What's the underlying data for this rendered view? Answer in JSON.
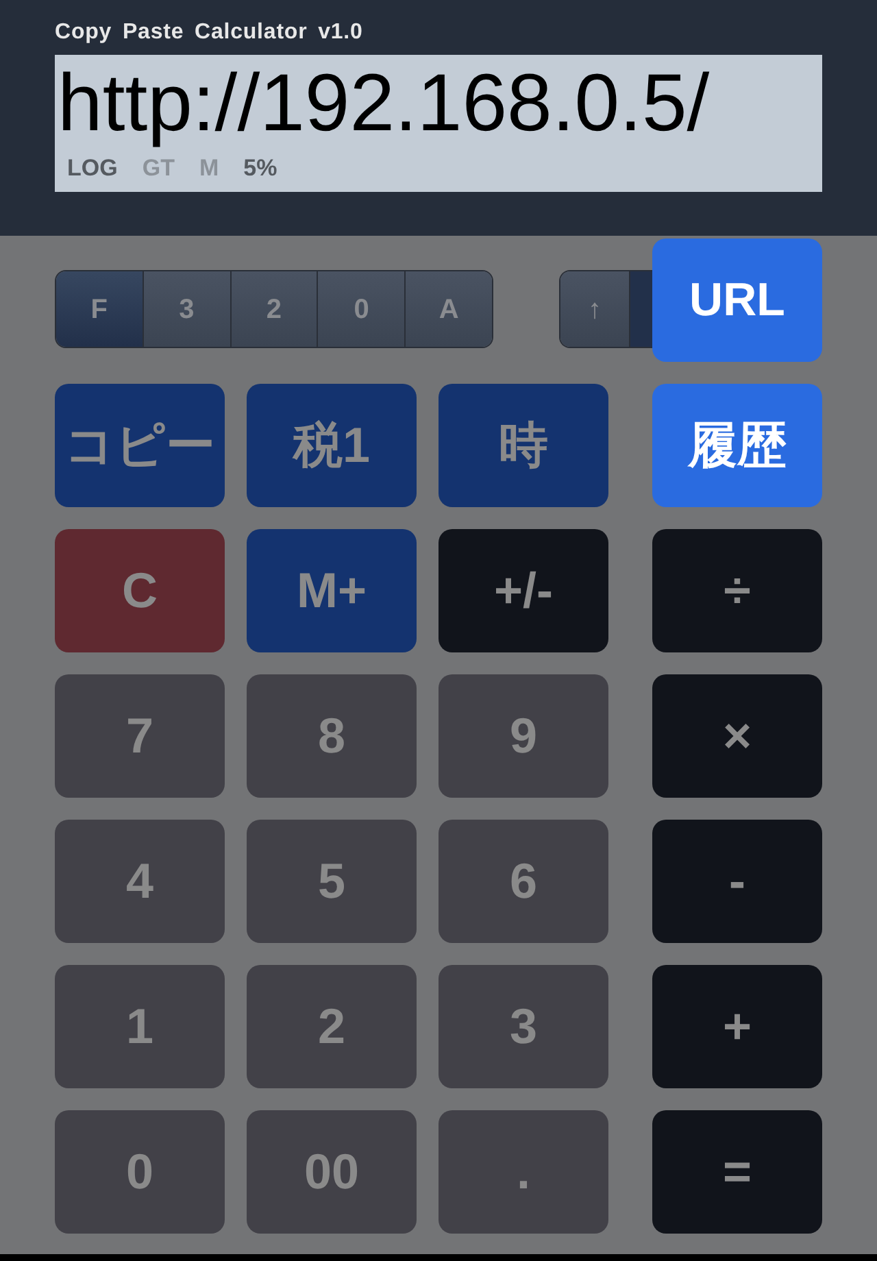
{
  "app_title": "Copy Paste Calculator v1.0",
  "display": {
    "value": "http://192.168.0.5/",
    "indicators": [
      {
        "label": "LOG",
        "on": true
      },
      {
        "label": "GT",
        "on": false
      },
      {
        "label": "M",
        "on": false
      },
      {
        "label": "5%",
        "on": true
      }
    ]
  },
  "decimal_selector": [
    {
      "label": "F",
      "selected": true
    },
    {
      "label": "3",
      "selected": false
    },
    {
      "label": "2",
      "selected": false
    },
    {
      "label": "0",
      "selected": false
    },
    {
      "label": "A",
      "selected": false
    }
  ],
  "rounding_selector": [
    {
      "label": "↑",
      "selected": false
    }
  ],
  "url_button": {
    "label": "URL"
  },
  "keys": [
    {
      "label": "コピー",
      "kind": "function"
    },
    {
      "label": "税1",
      "kind": "function"
    },
    {
      "label": "時",
      "kind": "function"
    },
    {
      "label": "履歴",
      "kind": "highlight"
    },
    {
      "label": "C",
      "kind": "clear"
    },
    {
      "label": "M+",
      "kind": "function"
    },
    {
      "label": "+/-",
      "kind": "operator"
    },
    {
      "label": "÷",
      "kind": "operator"
    },
    {
      "label": "7",
      "kind": "digit"
    },
    {
      "label": "8",
      "kind": "digit"
    },
    {
      "label": "9",
      "kind": "digit"
    },
    {
      "label": "×",
      "kind": "operator"
    },
    {
      "label": "4",
      "kind": "digit"
    },
    {
      "label": "5",
      "kind": "digit"
    },
    {
      "label": "6",
      "kind": "digit"
    },
    {
      "label": "-",
      "kind": "operator"
    },
    {
      "label": "1",
      "kind": "digit"
    },
    {
      "label": "2",
      "kind": "digit"
    },
    {
      "label": "3",
      "kind": "digit"
    },
    {
      "label": "+",
      "kind": "operator"
    },
    {
      "label": "0",
      "kind": "digit"
    },
    {
      "label": "00",
      "kind": "digit"
    },
    {
      "label": ".",
      "kind": "digit"
    },
    {
      "label": "=",
      "kind": "operator"
    }
  ]
}
